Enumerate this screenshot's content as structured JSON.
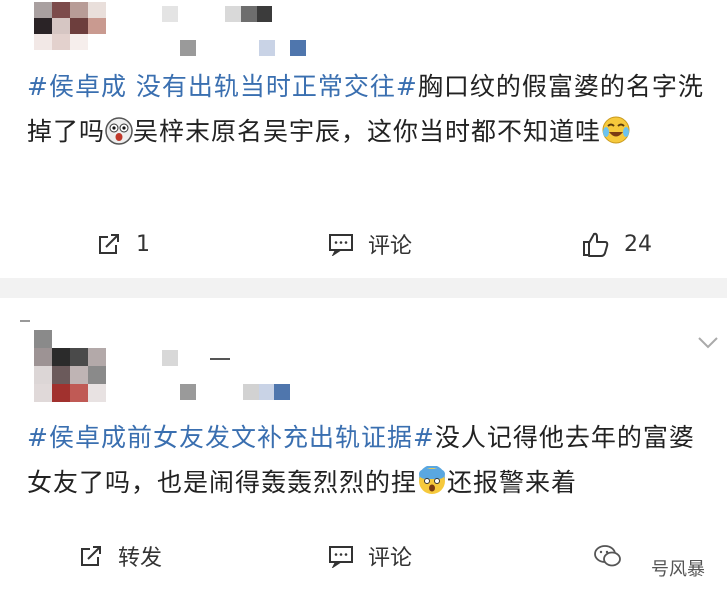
{
  "post1": {
    "tag": "#侯卓成 没有出轨当时正常交往#",
    "text_a": "胸口纹的假富婆的名字洗掉了吗",
    "text_b": "吴梓末原名吴宇辰，这你当时都不知道哇",
    "emoji_a": "shocked-emoji",
    "emoji_b": "laugh-cry-emoji",
    "actions": {
      "repost": "1",
      "comment": "评论",
      "like": "24"
    }
  },
  "post2": {
    "tag": "#侯卓成前女友发文补充出轨证据#",
    "text_a": "没人记得他去年的富婆女友了吗，也是闹得轰轰烈烈的捏",
    "text_b": "还报警来着",
    "emoji_a": "scared-emoji",
    "actions": {
      "repost": "转发",
      "comment": "评论"
    }
  },
  "watermark": "号风暴",
  "colors": {
    "tag": "#3a6fb0",
    "separator": "#f2f2f2"
  }
}
